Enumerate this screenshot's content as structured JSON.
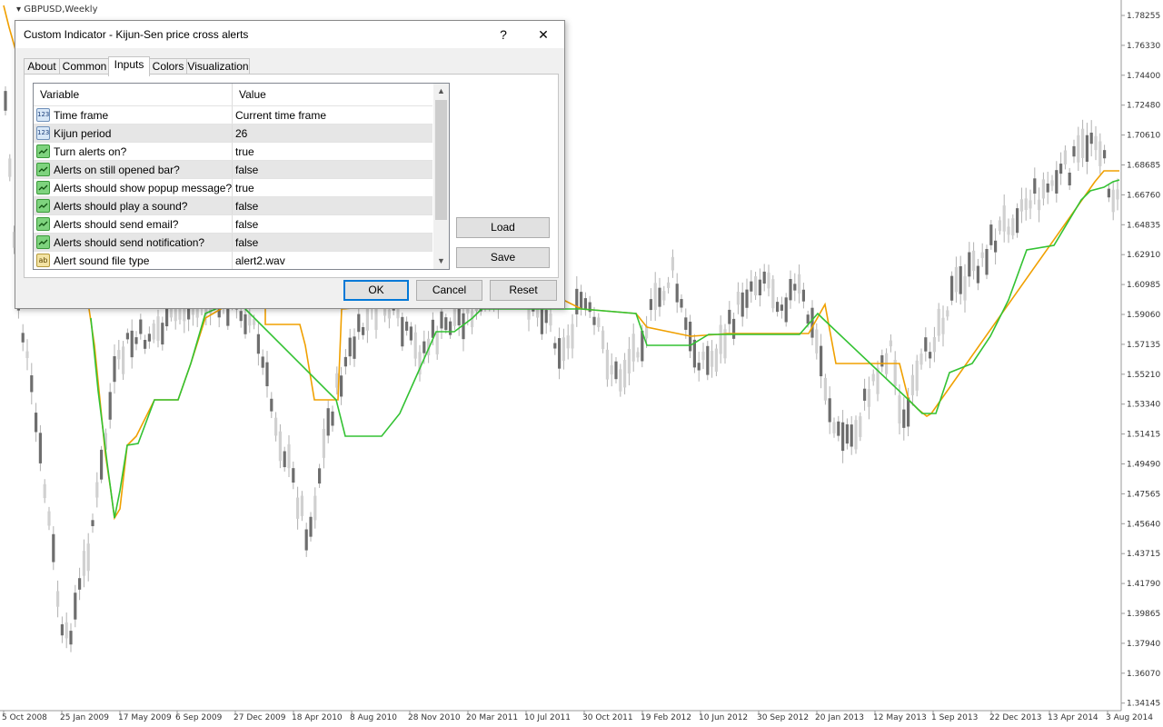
{
  "chart": {
    "symbol_label": "GBPUSD,Weekly",
    "price_labels": [
      "1.78255",
      "1.76330",
      "1.74400",
      "1.72480",
      "1.70610",
      "1.68685",
      "1.66760",
      "1.64835",
      "1.62910",
      "1.60985",
      "1.59060",
      "1.57135",
      "1.55210",
      "1.53340",
      "1.51415",
      "1.49490",
      "1.47565",
      "1.45640",
      "1.43715",
      "1.41790",
      "1.39865",
      "1.37940",
      "1.36070",
      "1.34145"
    ],
    "date_labels": [
      "5 Oct 2008",
      "25 Jan 2009",
      "17 May 2009",
      "6 Sep 2009",
      "27 Dec 2009",
      "18 Apr 2010",
      "8 Aug 2010",
      "28 Nov 2010",
      "20 Mar 2011",
      "10 Jul 2011",
      "30 Oct 2011",
      "19 Feb 2012",
      "10 Jun 2012",
      "30 Sep 2012",
      "20 Jan 2013",
      "12 May 2013",
      "1 Sep 2013",
      "22 Dec 2013",
      "13 Apr 2014",
      "3 Aug 2014"
    ],
    "colors": {
      "candle": "#8c8c8c",
      "kijun_line": "#f0a000",
      "signal_line": "#33c233",
      "grid_text": "#333333"
    }
  },
  "dialog": {
    "title": "Custom Indicator - Kijun-Sen price cross alerts",
    "help_label": "?",
    "close_label": "✕",
    "tabs": [
      {
        "label": "About"
      },
      {
        "label": "Common"
      },
      {
        "label": "Inputs"
      },
      {
        "label": "Colors"
      },
      {
        "label": "Visualization"
      }
    ],
    "active_tab": "Inputs",
    "table": {
      "col_variable": "Variable",
      "col_value": "Value",
      "rows": [
        {
          "icon": "123",
          "variable": "Time frame",
          "value": "Current time frame"
        },
        {
          "icon": "123",
          "variable": "Kijun period",
          "value": "26"
        },
        {
          "icon": "bool",
          "variable": "Turn alerts on?",
          "value": "true"
        },
        {
          "icon": "bool",
          "variable": "Alerts on still opened bar?",
          "value": "false"
        },
        {
          "icon": "bool",
          "variable": "Alerts should show popup message?",
          "value": "true"
        },
        {
          "icon": "bool",
          "variable": "Alerts should play a sound?",
          "value": "false"
        },
        {
          "icon": "bool",
          "variable": "Alerts should send email?",
          "value": "false"
        },
        {
          "icon": "bool",
          "variable": "Alerts should send notification?",
          "value": "false"
        },
        {
          "icon": "ab",
          "variable": "Alert sound file type",
          "value": "alert2.wav"
        }
      ]
    },
    "load_label": "Load",
    "save_label": "Save",
    "ok_label": "OK",
    "cancel_label": "Cancel",
    "reset_label": "Reset"
  }
}
